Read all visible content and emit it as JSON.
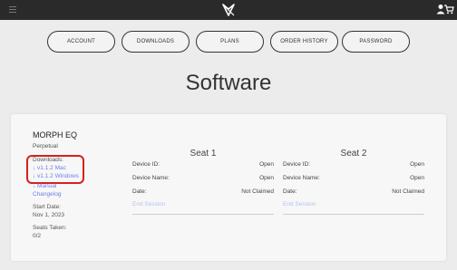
{
  "nav": {
    "account": "ACCOUNT",
    "downloads": "DOWNLOADS",
    "plans": "PLANS",
    "order_history": "ORDER HISTORY",
    "password": "PASSWORD"
  },
  "page": {
    "title": "Software"
  },
  "product": {
    "name": "MORPH EQ",
    "license": "Perpetual",
    "downloads_label": "Downloads:",
    "download_mac": "↓ v1.1.2 Mac",
    "download_windows": "↓ v1.1.2 Windows",
    "manual": "↓ Manual",
    "changelog": "Changelog",
    "start_date_label": "Start Date:",
    "start_date": "Nov 1, 2023",
    "seats_taken_label": "Seats Taken:",
    "seats_taken": "0/2"
  },
  "seats": [
    {
      "title": "Seat 1",
      "device_id_label": "Device ID:",
      "device_id": "Open",
      "device_name_label": "Device Name:",
      "device_name": "Open",
      "date_label": "Date:",
      "date": "Not Claimed",
      "end_session": "End Session"
    },
    {
      "title": "Seat 2",
      "device_id_label": "Device ID:",
      "device_id": "Open",
      "device_name_label": "Device Name:",
      "device_name": "Open",
      "date_label": "Date:",
      "date": "Not Claimed",
      "end_session": "End Session"
    }
  ],
  "colors": {
    "topbar": "#2a2a2a",
    "link": "#6b7ee8",
    "highlight": "#d72020",
    "disabled_link": "#b8c1f0"
  },
  "icons": [
    "hamburger-menu-icon",
    "brand-logo-icon",
    "user-icon",
    "cart-icon"
  ]
}
